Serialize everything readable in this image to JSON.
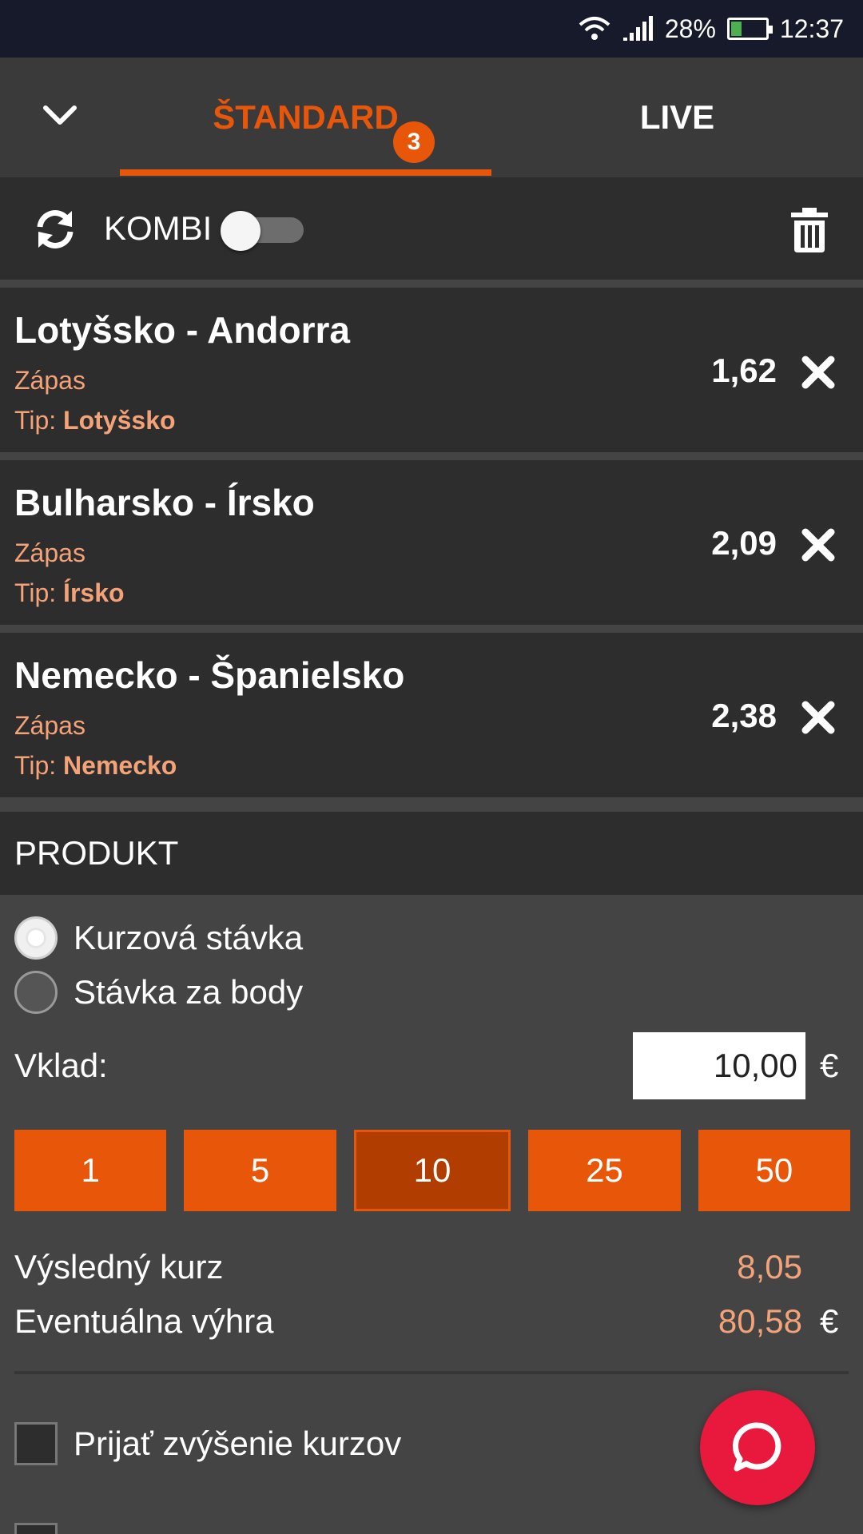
{
  "status_bar": {
    "battery": "28%",
    "time": "12:37"
  },
  "tabs": {
    "standard": "ŠTANDARD",
    "standard_count": "3",
    "live": "LIVE"
  },
  "toolbar": {
    "kombi_label": "KOMBI",
    "kombi_on": false
  },
  "bets": [
    {
      "match": "Lotyšsko - Andorra",
      "type": "Zápas",
      "tip_label": "Tip:",
      "tip": "Lotyšsko",
      "odds": "1,62"
    },
    {
      "match": "Bulharsko - Írsko",
      "type": "Zápas",
      "tip_label": "Tip:",
      "tip": "Írsko",
      "odds": "2,09"
    },
    {
      "match": "Nemecko - Španielsko",
      "type": "Zápas",
      "tip_label": "Tip:",
      "tip": "Nemecko",
      "odds": "2,38"
    }
  ],
  "produkt": {
    "title": "PRODUKT",
    "options": [
      {
        "label": "Kurzová stávka",
        "selected": true
      },
      {
        "label": "Stávka za body",
        "selected": false
      }
    ]
  },
  "stake": {
    "label": "Vklad:",
    "value": "10,00",
    "currency": "€",
    "presets": [
      "1",
      "5",
      "10",
      "25",
      "50"
    ],
    "selected_preset": "10"
  },
  "summary": {
    "odds_label": "Výsledný kurz",
    "odds_value": "8,05",
    "win_label": "Eventuálna výhra",
    "win_value": "80,58",
    "currency": "€"
  },
  "options": {
    "accept_increase": "Prijať zvýšenie kurzov"
  },
  "colors": {
    "accent": "#e8560a",
    "accent_text": "#f4a278",
    "fab": "#e8193c"
  }
}
